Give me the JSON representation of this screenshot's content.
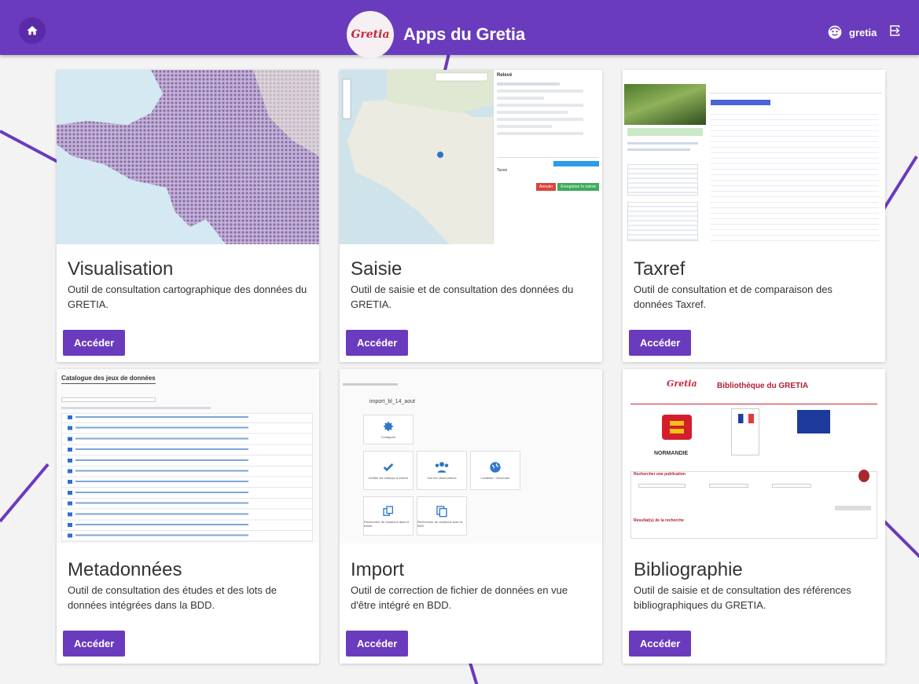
{
  "header": {
    "title": "Apps du Gretia",
    "logo_text": "Gretia",
    "user_name": "gretia"
  },
  "colors": {
    "brand": "#6a3bbd",
    "background": "#f3f3f4"
  },
  "icons": {
    "home": "home-icon",
    "user": "user-face-icon",
    "logout": "logout-icon"
  },
  "cards": [
    {
      "title": "Visualisation",
      "description": "Outil de consultation cartographique des données du GRETIA.",
      "button": "Accéder"
    },
    {
      "title": "Saisie",
      "description": "Outil de saisie et de consultation des données du GRETIA.",
      "button": "Accéder"
    },
    {
      "title": "Taxref",
      "description": "Outil de consultation et de comparaison des données Taxref.",
      "button": "Accéder"
    },
    {
      "title": "Metadonnées",
      "description": "Outil de consultation des études et des lots de données intégrées dans la BDD.",
      "button": "Accéder"
    },
    {
      "title": "Import",
      "description": "Outil de correction de fichier de données en vue d'être intégré en BDD.",
      "button": "Accéder"
    },
    {
      "title": "Bibliographie",
      "description": "Outil de saisie et de consultation des références bibliographiques du GRETIA.",
      "button": "Accéder"
    }
  ],
  "previews": {
    "saisie": {
      "panel_title": "Relevé",
      "taxon_label": "Taxon",
      "cancel": "Annuler",
      "save": "Enregistrer le relevé"
    },
    "metadata": {
      "heading": "Catalogue des jeux de données"
    },
    "import": {
      "filename": "import_bl_14_aout",
      "tiles": [
        "Configurer",
        "Vérifier les champs à insérer",
        "Voir les observateurs",
        "Localiser / Géocoder",
        "Rechercher de doublons dans le fichier",
        "Rechercher de doublons avec la BDD"
      ]
    },
    "biblio": {
      "logo": "Gretia",
      "heading": "Bibliothèque du GRETIA",
      "region": "NORMANDIE",
      "search_heading": "Rechercher une publication",
      "results_heading": "Résultat(s) de la recherche"
    }
  }
}
